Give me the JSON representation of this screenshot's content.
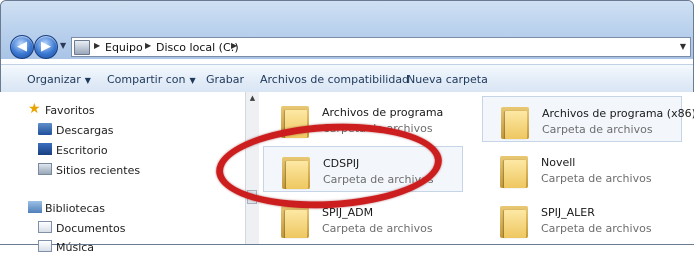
{
  "address": {
    "crumbs": [
      "Equipo",
      "Disco local (C:)"
    ]
  },
  "toolbar": {
    "organize": "Organizar",
    "share": "Compartir con",
    "burn": "Grabar",
    "compat": "Archivos de compatibilidad",
    "new_folder": "Nueva carpeta"
  },
  "nav": {
    "favorites": "Favoritos",
    "downloads": "Descargas",
    "desktop": "Escritorio",
    "recent": "Sitios recientes",
    "libraries": "Bibliotecas",
    "documents": "Documentos",
    "music": "Música"
  },
  "files": [
    {
      "name": "Archivos de programa",
      "type": "Carpeta de archivos"
    },
    {
      "name": "Archivos de programa (x86)",
      "type": "Carpeta de archivos"
    },
    {
      "name": "CDSPIJ",
      "type": "Carpeta de archivos"
    },
    {
      "name": "Novell",
      "type": "Carpeta de archivos"
    },
    {
      "name": "SPIJ_ADM",
      "type": "Carpeta de archivos"
    },
    {
      "name": "SPIJ_ALER",
      "type": "Carpeta de archivos"
    }
  ],
  "colors": {
    "annotation": "#cc1e1e",
    "accent": "#1e395b"
  },
  "icons": {
    "back": "back-arrow-icon",
    "forward": "forward-arrow-icon",
    "folder": "folder-icon"
  }
}
